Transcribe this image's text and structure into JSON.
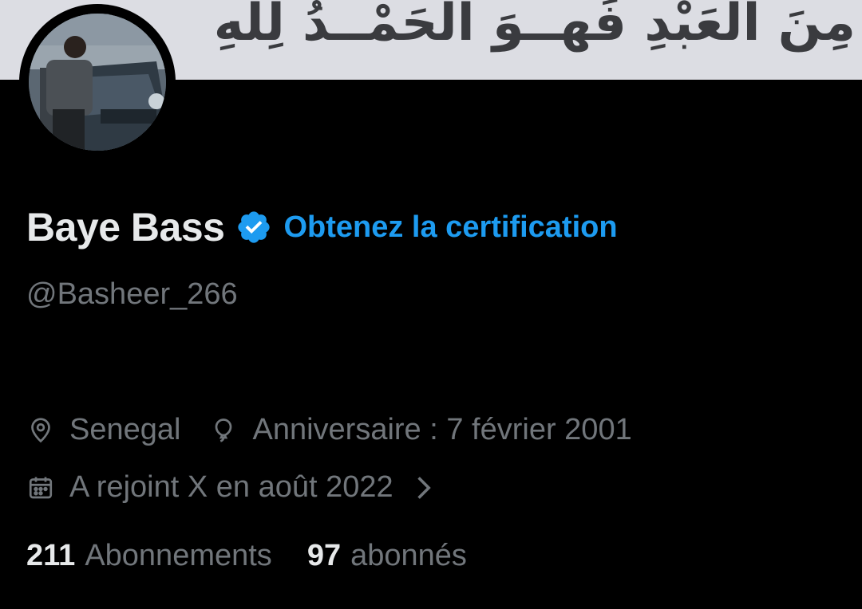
{
  "banner": {
    "text": "مِنَ العَبْدِ فَهــوَ الحَمْــدُ لِلهِ"
  },
  "profile": {
    "display_name": "Baye Bass",
    "certification_link": "Obtenez la certification",
    "handle": "@Basheer_266",
    "avatar_icon": "profile-photo",
    "verified_icon": "verified-badge-icon"
  },
  "meta": {
    "location": "Senegal",
    "birthday": "Anniversaire : 7 février 2001",
    "joined": "A rejoint X en août 2022"
  },
  "stats": {
    "following_count": "211",
    "following_label": "Abonnements",
    "followers_count": "97",
    "followers_label": "abonnés"
  },
  "colors": {
    "accent": "#1d9bf0",
    "secondary_text": "#71767b",
    "primary_text": "#e7e9ea",
    "background": "#000000",
    "banner": "#dcdde3"
  }
}
